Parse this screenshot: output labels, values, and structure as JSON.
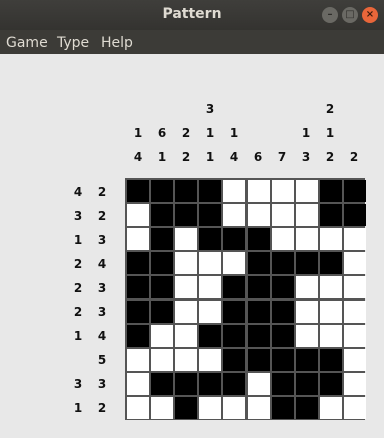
{
  "window": {
    "title": "Pattern",
    "controls": [
      "minimize",
      "maximize",
      "close"
    ]
  },
  "menu": {
    "items": [
      "Game",
      "Type",
      "Help"
    ]
  },
  "puzzle": {
    "col_clues": [
      [
        "1",
        "4"
      ],
      [
        "6",
        "1"
      ],
      [
        "2",
        "2"
      ],
      [
        "3",
        "1",
        "1"
      ],
      [
        "1",
        "4"
      ],
      [
        "6"
      ],
      [
        "7"
      ],
      [
        "1",
        "3"
      ],
      [
        "2",
        "1",
        "2"
      ],
      [
        "2"
      ]
    ],
    "row_clues": [
      [
        "4",
        "2"
      ],
      [
        "3",
        "2"
      ],
      [
        "1",
        "3"
      ],
      [
        "2",
        "4"
      ],
      [
        "2",
        "3"
      ],
      [
        "2",
        "3"
      ],
      [
        "1",
        "4"
      ],
      [
        "5"
      ],
      [
        "3",
        "3"
      ],
      [
        "1",
        "2"
      ]
    ],
    "grid": [
      "1111000011",
      "0111000011",
      "0101110000",
      "1100011110",
      "1100111000",
      "1100111000",
      "1001111000",
      "0000111110",
      "0111101110",
      "0010001100"
    ]
  },
  "colors": {
    "filled": "#000000",
    "empty": "#ffffff",
    "grid_line": "#555555",
    "titlebar": "#3c3b37"
  }
}
